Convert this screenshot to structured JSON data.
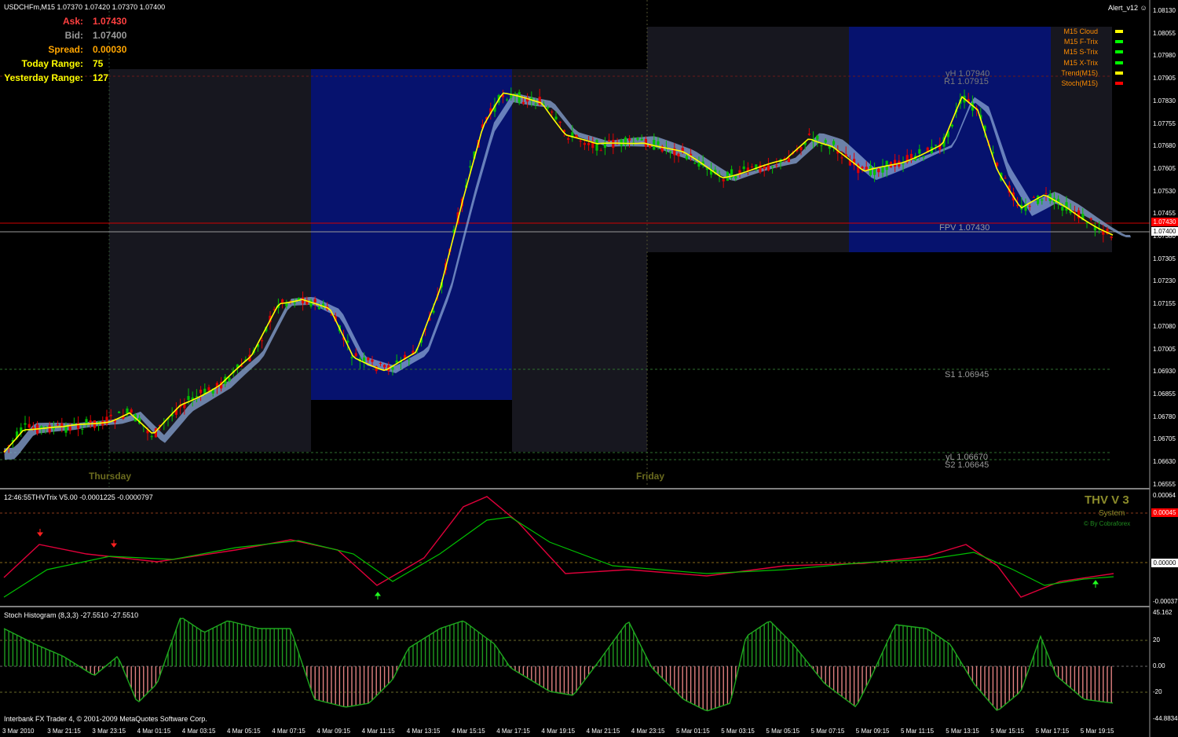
{
  "main_pane": {
    "header": "USDCHFm,M15  1.07370 1.07420 1.07370 1.07400",
    "indicator_name": "Alert_v12",
    "info": [
      {
        "label": "Ask:",
        "value": "1.07430",
        "label_color": "#ff4040",
        "value_color": "#ff4040"
      },
      {
        "label": "Bid:",
        "value": "1.07400",
        "label_color": "#9a9a9a",
        "value_color": "#9a9a9a"
      },
      {
        "label": "Spread:",
        "value": "0.00030",
        "label_color": "#ffa500",
        "value_color": "#ffa500"
      },
      {
        "label": "Today Range:",
        "value": "75",
        "label_color": "#ffff00",
        "value_color": "#ffff00"
      },
      {
        "label": "Yesterday Range:",
        "value": "127",
        "label_color": "#ffff00",
        "value_color": "#ffff00"
      }
    ],
    "legend": [
      {
        "label": "M15 Cloud",
        "color": "#ffff00"
      },
      {
        "label": "M15 F-Trix",
        "color": "#00ff00"
      },
      {
        "label": "M15 S-Trix",
        "color": "#00ff00"
      },
      {
        "label": "M15 X-Trix",
        "color": "#00ff00"
      },
      {
        "label": "Trend(M15)",
        "color": "#ffff00"
      },
      {
        "label": "Stoch(M15)",
        "color": "#ff0000"
      }
    ],
    "day_labels": [
      "Thursday",
      "Friday"
    ],
    "levels": {
      "yH": "yH  1.07940",
      "R1": "R1  1.07915",
      "FPV": "FPV  1.07430",
      "S1": "S1  1.06945",
      "yL": "yL  1.06670",
      "S2": "S2  1.06645"
    },
    "price_axis": [
      "1.08130",
      "1.08055",
      "1.07980",
      "1.07905",
      "1.07830",
      "1.07755",
      "1.07680",
      "1.07605",
      "1.07530",
      "1.07455",
      "1.07380",
      "1.07305",
      "1.07230",
      "1.07155",
      "1.07080",
      "1.07005",
      "1.06930",
      "1.06855",
      "1.06780",
      "1.06705",
      "1.06630",
      "1.06555"
    ],
    "ask_tag": "1.07430",
    "bid_tag": "1.07400",
    "colors": {
      "bull": "#00c000",
      "bear": "#e00000",
      "ma": "#ffff00",
      "cloud": "#8aa6d6",
      "session_blue": "#06126e",
      "session_dark": "#17171f"
    }
  },
  "trix_pane": {
    "header": "12:46:55THVTrix V5.00 -0.0001225 -0.0000797",
    "brand_title": "THV V 3",
    "brand_sub": "System",
    "brand_credit": "© By Cobraforex",
    "axis": [
      "0.00064",
      "0.00045",
      "0.00000",
      "-0.00037"
    ]
  },
  "stoch_pane": {
    "header": "Stoch Histogram (8,3,3) -27.5510 -27.5510",
    "axis": [
      "45.162",
      "20",
      "0.00",
      "-20",
      "-44.8834"
    ],
    "footer": "Interbank FX Trader 4, © 2001-2009 MetaQuotes Software Corp."
  },
  "time_axis": [
    "3 Mar 2010",
    "3 Mar 21:15",
    "3 Mar 23:15",
    "4 Mar 01:15",
    "4 Mar 03:15",
    "4 Mar 05:15",
    "4 Mar 07:15",
    "4 Mar 09:15",
    "4 Mar 11:15",
    "4 Mar 13:15",
    "4 Mar 15:15",
    "4 Mar 17:15",
    "4 Mar 19:15",
    "4 Mar 21:15",
    "4 Mar 23:15",
    "5 Mar 01:15",
    "5 Mar 03:15",
    "5 Mar 05:15",
    "5 Mar 07:15",
    "5 Mar 09:15",
    "5 Mar 11:15",
    "5 Mar 13:15",
    "5 Mar 15:15",
    "5 Mar 17:15",
    "5 Mar 19:15"
  ]
}
